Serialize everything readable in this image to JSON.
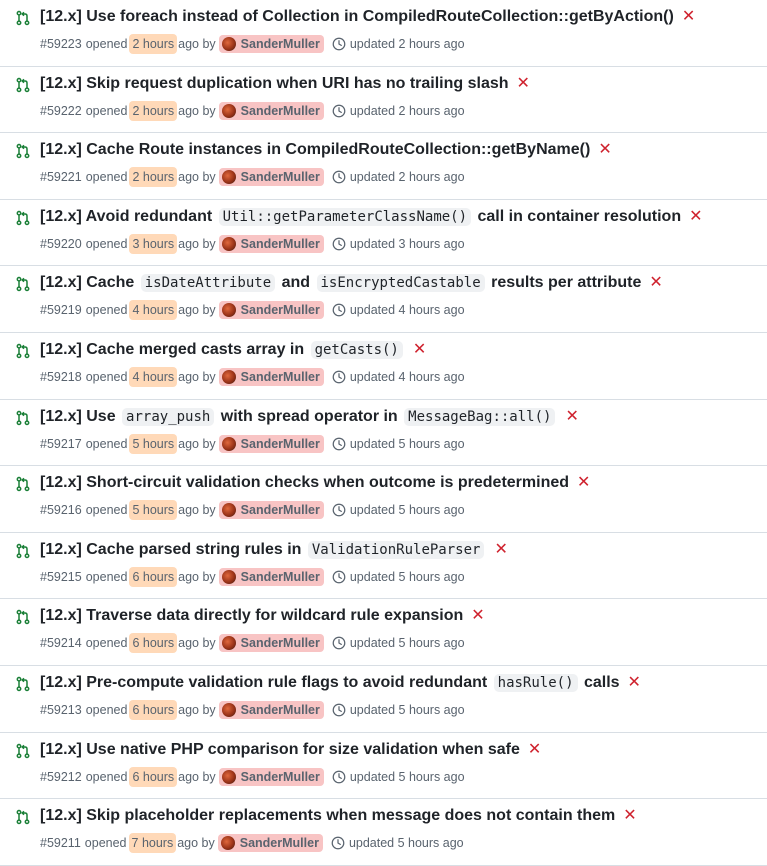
{
  "colors": {
    "title": "#1f2328",
    "meta": "#59636e",
    "icon_green": "#1a7f37",
    "x_red": "#cf222e",
    "time_highlight": "#ffd9b8",
    "author_highlight": "#f8c4c4",
    "code_bg": "#eff1f3",
    "divider": "#d8dee4"
  },
  "icons": {
    "pr": "git-pull-request-icon",
    "status": "x-close-icon",
    "clock": "clock-icon"
  },
  "pull_requests": [
    {
      "title_segments": [
        {
          "type": "text",
          "value": "[12.x] Use foreach instead of Collection in CompiledRouteCollection::getByAction()"
        }
      ],
      "number": "#59223",
      "opened_label": "opened",
      "opened_time": "2 hours",
      "ago_by": "ago by",
      "author": "SanderMuller",
      "updated": "updated 2 hours ago"
    },
    {
      "title_segments": [
        {
          "type": "text",
          "value": "[12.x] Skip request duplication when URI has no trailing slash"
        }
      ],
      "number": "#59222",
      "opened_label": "opened",
      "opened_time": "2 hours",
      "ago_by": "ago by",
      "author": "SanderMuller",
      "updated": "updated 2 hours ago"
    },
    {
      "title_segments": [
        {
          "type": "text",
          "value": "[12.x] Cache Route instances in CompiledRouteCollection::getByName()"
        }
      ],
      "number": "#59221",
      "opened_label": "opened",
      "opened_time": "2 hours",
      "ago_by": "ago by",
      "author": "SanderMuller",
      "updated": "updated 2 hours ago"
    },
    {
      "title_segments": [
        {
          "type": "text",
          "value": "[12.x] Avoid redundant "
        },
        {
          "type": "code",
          "value": "Util::getParameterClassName()"
        },
        {
          "type": "text",
          "value": " call in container resolution"
        }
      ],
      "number": "#59220",
      "opened_label": "opened",
      "opened_time": "3 hours",
      "ago_by": "ago by",
      "author": "SanderMuller",
      "updated": "updated 3 hours ago"
    },
    {
      "title_segments": [
        {
          "type": "text",
          "value": "[12.x] Cache "
        },
        {
          "type": "code",
          "value": "isDateAttribute"
        },
        {
          "type": "text",
          "value": " and "
        },
        {
          "type": "code",
          "value": "isEncryptedCastable"
        },
        {
          "type": "text",
          "value": " results per attribute"
        }
      ],
      "number": "#59219",
      "opened_label": "opened",
      "opened_time": "4 hours",
      "ago_by": "ago by",
      "author": "SanderMuller",
      "updated": "updated 4 hours ago"
    },
    {
      "title_segments": [
        {
          "type": "text",
          "value": "[12.x] Cache merged casts array in "
        },
        {
          "type": "code",
          "value": "getCasts()"
        }
      ],
      "number": "#59218",
      "opened_label": "opened",
      "opened_time": "4 hours",
      "ago_by": "ago by",
      "author": "SanderMuller",
      "updated": "updated 4 hours ago"
    },
    {
      "title_segments": [
        {
          "type": "text",
          "value": "[12.x] Use "
        },
        {
          "type": "code",
          "value": "array_push"
        },
        {
          "type": "text",
          "value": " with spread operator in "
        },
        {
          "type": "code",
          "value": "MessageBag::all()"
        }
      ],
      "number": "#59217",
      "opened_label": "opened",
      "opened_time": "5 hours",
      "ago_by": "ago by",
      "author": "SanderMuller",
      "updated": "updated 5 hours ago"
    },
    {
      "title_segments": [
        {
          "type": "text",
          "value": "[12.x] Short-circuit validation checks when outcome is predetermined"
        }
      ],
      "number": "#59216",
      "opened_label": "opened",
      "opened_time": "5 hours",
      "ago_by": "ago by",
      "author": "SanderMuller",
      "updated": "updated 5 hours ago"
    },
    {
      "title_segments": [
        {
          "type": "text",
          "value": "[12.x] Cache parsed string rules in "
        },
        {
          "type": "code",
          "value": "ValidationRuleParser"
        }
      ],
      "number": "#59215",
      "opened_label": "opened",
      "opened_time": "6 hours",
      "ago_by": "ago by",
      "author": "SanderMuller",
      "updated": "updated 5 hours ago"
    },
    {
      "title_segments": [
        {
          "type": "text",
          "value": "[12.x] Traverse data directly for wildcard rule expansion"
        }
      ],
      "number": "#59214",
      "opened_label": "opened",
      "opened_time": "6 hours",
      "ago_by": "ago by",
      "author": "SanderMuller",
      "updated": "updated 5 hours ago"
    },
    {
      "title_segments": [
        {
          "type": "text",
          "value": "[12.x] Pre-compute validation rule flags to avoid redundant "
        },
        {
          "type": "code",
          "value": "hasRule()"
        },
        {
          "type": "text",
          "value": " calls"
        }
      ],
      "number": "#59213",
      "opened_label": "opened",
      "opened_time": "6 hours",
      "ago_by": "ago by",
      "author": "SanderMuller",
      "updated": "updated 5 hours ago"
    },
    {
      "title_segments": [
        {
          "type": "text",
          "value": "[12.x] Use native PHP comparison for size validation when safe"
        }
      ],
      "number": "#59212",
      "opened_label": "opened",
      "opened_time": "6 hours",
      "ago_by": "ago by",
      "author": "SanderMuller",
      "updated": "updated 5 hours ago"
    },
    {
      "title_segments": [
        {
          "type": "text",
          "value": "[12.x] Skip placeholder replacements when message does not contain them"
        }
      ],
      "number": "#59211",
      "opened_label": "opened",
      "opened_time": "7 hours",
      "ago_by": "ago by",
      "author": "SanderMuller",
      "updated": "updated 5 hours ago"
    }
  ]
}
